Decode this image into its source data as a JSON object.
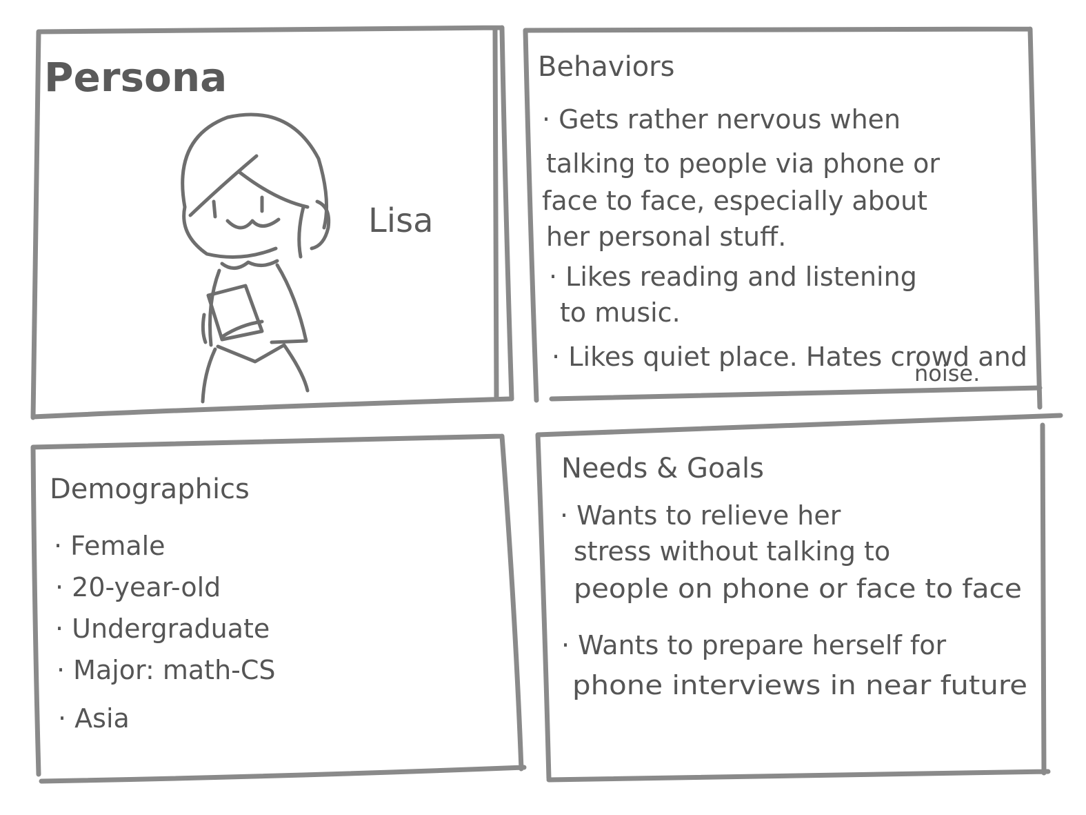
{
  "persona": {
    "title": "Persona",
    "name": "Lisa"
  },
  "behaviors": {
    "title": "Behaviors",
    "lines": [
      "· Gets rather nervous when",
      "talking to people via phone or",
      "face to face, especially about",
      "her personal stuff.",
      "· Likes reading and listening",
      "to music.",
      "· Likes quiet place. Hates crowd and",
      "noise."
    ]
  },
  "demographics": {
    "title": "Demographics",
    "items": [
      "· Female",
      "· 20-year-old",
      "· Undergraduate",
      "· Major: math-CS",
      "· Asia"
    ]
  },
  "needs_goals": {
    "title": "Needs & Goals",
    "lines": [
      "· Wants to relieve her",
      "stress without talking to",
      "people on phone or face to face",
      "· Wants to prepare herself for",
      "phone interviews in near future"
    ]
  },
  "colors": {
    "ink": "#555555",
    "frame": "#8a8a8a",
    "paper": "#ffffff"
  }
}
